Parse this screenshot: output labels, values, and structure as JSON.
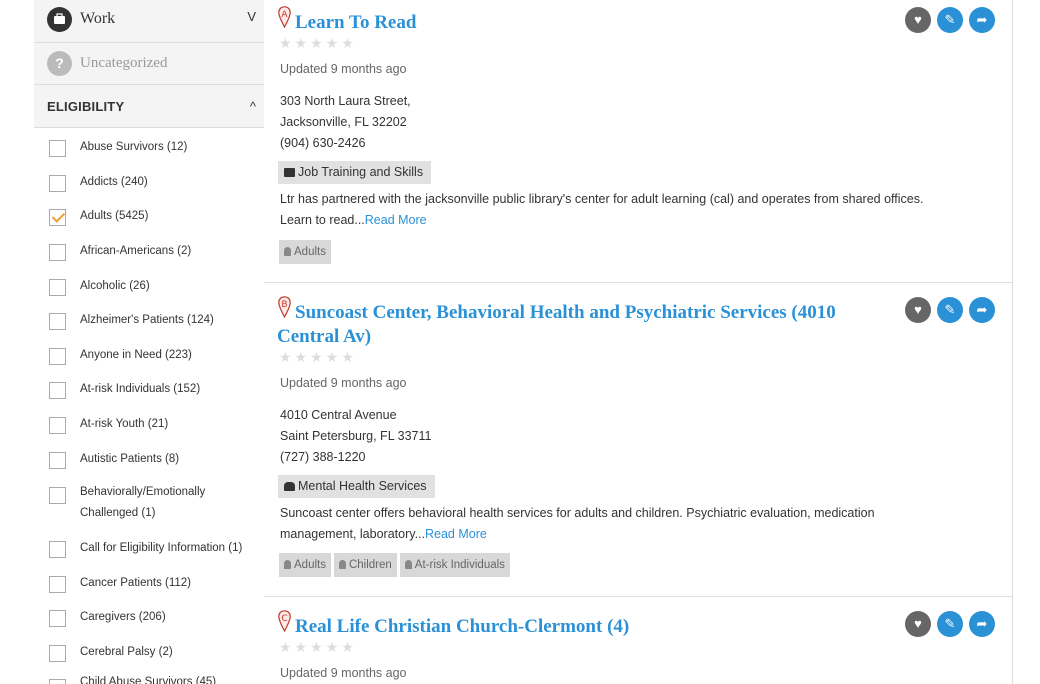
{
  "sidebar": {
    "work_label": "Work",
    "work_chevron": "V",
    "uncategorized_label": "Uncategorized",
    "uncategorized_icon": "?",
    "eligibility_heading": "ELIGIBILITY",
    "eligibility_chevron": "^",
    "options": [
      {
        "label": "Abuse Survivors (12)",
        "checked": false
      },
      {
        "label": "Addicts (240)",
        "checked": false
      },
      {
        "label": "Adults (5425)",
        "checked": true
      },
      {
        "label": "African-Americans (2)",
        "checked": false
      },
      {
        "label": "Alcoholic (26)",
        "checked": false
      },
      {
        "label": "Alzheimer's Patients (124)",
        "checked": false
      },
      {
        "label": "Anyone in Need (223)",
        "checked": false
      },
      {
        "label": "At-risk Individuals (152)",
        "checked": false
      },
      {
        "label": "At-risk Youth (21)",
        "checked": false
      },
      {
        "label": "Autistic Patients (8)",
        "checked": false
      },
      {
        "label": "Behaviorally/Emotionally Challenged (1)",
        "checked": false
      },
      {
        "label": "Call for Eligibility Information (1)",
        "checked": false
      },
      {
        "label": "Cancer Patients (112)",
        "checked": false
      },
      {
        "label": "Caregivers (206)",
        "checked": false
      },
      {
        "label": "Cerebral Palsy (2)",
        "checked": false
      },
      {
        "label": "Child Abuse Survivors (45)",
        "checked": false
      }
    ]
  },
  "results": [
    {
      "marker": "A",
      "title": "Learn To Read",
      "stars": "★★★★★",
      "updated": "Updated 9 months ago",
      "address1": "303 North Laura Street,",
      "address2": "Jacksonville, FL 32202",
      "phone": "(904) 630-2426",
      "category": "Job Training and Skills",
      "description": "Ltr has partnered with the jacksonville public library's center for adult learning (cal) and operates from shared offices. Learn to read...",
      "read_more": "Read More",
      "tags": [
        "Adults"
      ]
    },
    {
      "marker": "B",
      "title": "Suncoast Center, Behavioral Health and Psychiatric Services (4010 Central Av)",
      "stars": "★★★★★",
      "updated": "Updated 9 months ago",
      "address1": "4010 Central Avenue",
      "address2": "Saint Petersburg, FL 33711",
      "phone": "(727) 388-1220",
      "category": "Mental Health Services",
      "description": "Suncoast center offers behavioral health services for adults and children. Psychiatric evaluation, medication management, laboratory...",
      "read_more": "Read More",
      "tags": [
        "Adults",
        "Children",
        "At-risk Individuals"
      ]
    },
    {
      "marker": "C",
      "title": "Real Life Christian Church-Clermont (4)",
      "stars": "★★★★★",
      "updated": "Updated 9 months ago"
    }
  ],
  "actions": {
    "favorite": "♥",
    "edit": "✎",
    "share": "➦"
  },
  "colors": {
    "link": "#2a91d6",
    "marker": "#c0392b",
    "check": "#f0a030"
  }
}
